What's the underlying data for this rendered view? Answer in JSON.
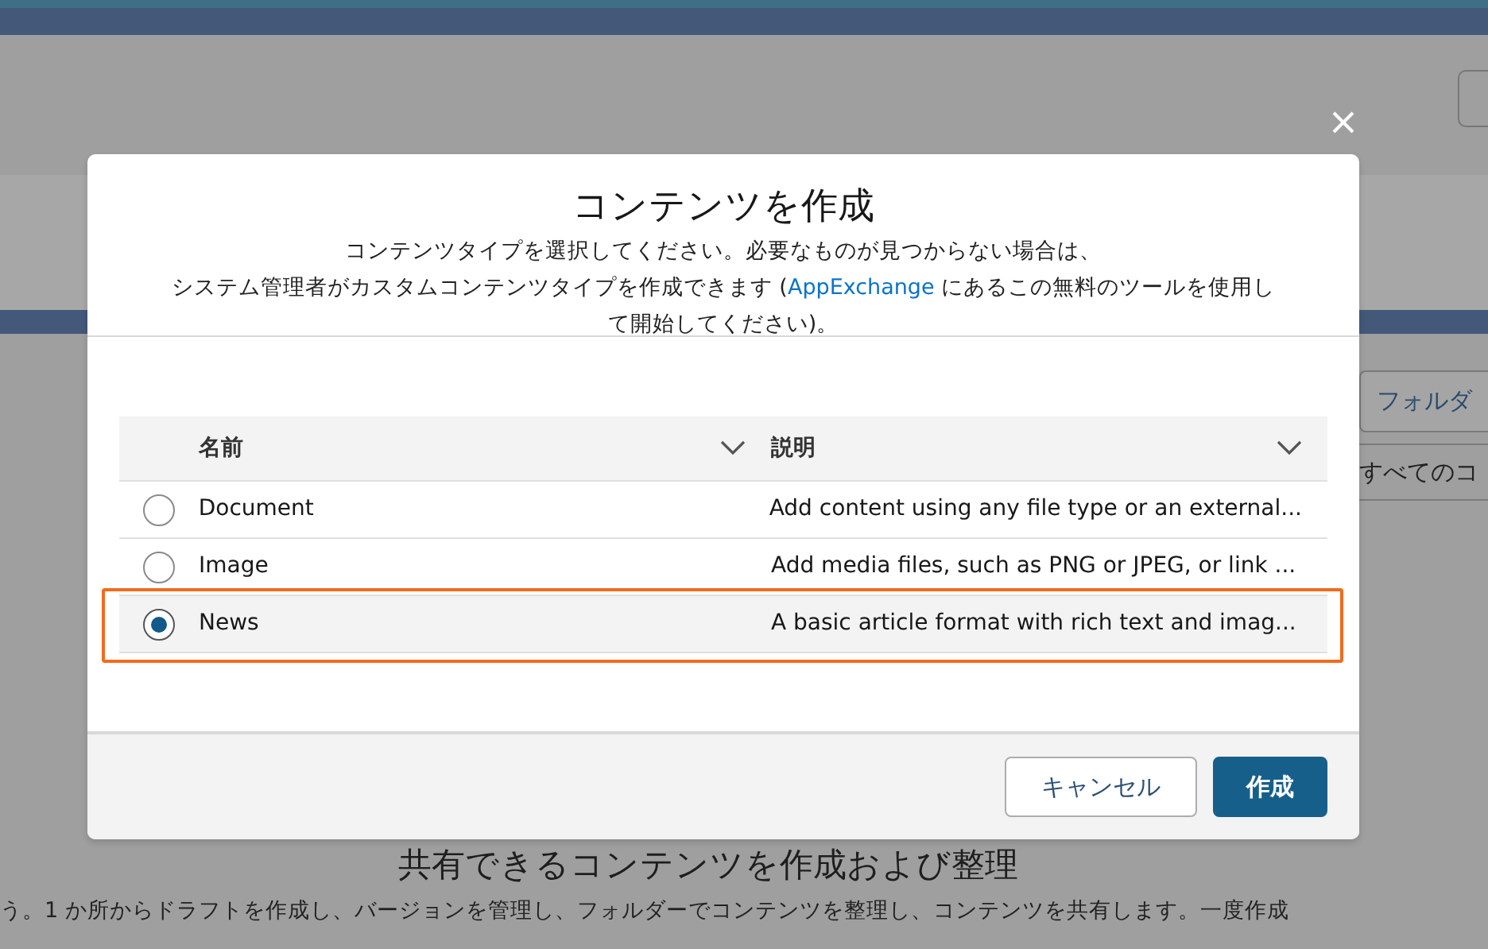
{
  "background": {
    "folder_button": "フォルダ",
    "filter_label": "すべてのコ",
    "heading": "共有できるコンテンツを作成および整理",
    "body_text": "う。1 か所からドラフトを作成し、バージョンを管理し、フォルダーでコンテンツを整理し、コンテンツを共有します。一度作成"
  },
  "modal": {
    "title": "コンテンツを作成",
    "description": {
      "line_1": "コンテンツタイプを選択してください。必要なものが見つからない場合は、",
      "before_link": "システム管理者がカスタムコンテンツタイプを作成できます (",
      "link": "AppExchange",
      "after_link": " にあるこの無料のツールを使用して開始してください)。"
    },
    "table": {
      "columns": [
        {
          "label": "名前"
        },
        {
          "label": "説明"
        }
      ],
      "rows": [
        {
          "name": "Document",
          "description": "Add content using any file type or an external...",
          "selected": false
        },
        {
          "name": "Image",
          "description": "Add media files, such as PNG or JPEG, or link ...",
          "selected": false
        },
        {
          "name": "News",
          "description": "A basic article format with rich text and imag...",
          "selected": true
        }
      ]
    },
    "buttons": [
      {
        "kind": "neutral",
        "label": "キャンセル"
      },
      {
        "kind": "brand",
        "label": "作成"
      }
    ]
  }
}
